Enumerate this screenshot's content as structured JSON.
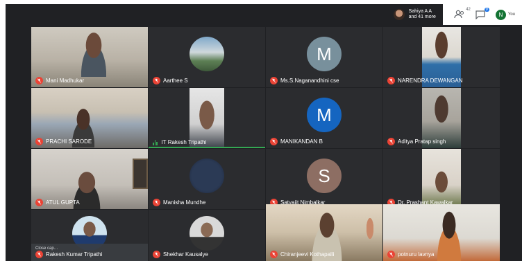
{
  "topbar": {
    "presenter_name": "Sahiya A A",
    "presenter_more": "and 41 more",
    "people_count": "42",
    "chat_badge": "9",
    "self_initial": "N",
    "self_label": "You",
    "self_badge": "9"
  },
  "participants": [
    {
      "name": "Mani Madhukar",
      "kind": "video"
    },
    {
      "name": "Aarthee S",
      "kind": "photo"
    },
    {
      "name": "Ms.S.Naganandhini cse",
      "kind": "letter",
      "initial": "M",
      "color": "#78909c"
    },
    {
      "name": "NARENDRA DEWANGAN",
      "kind": "video"
    },
    {
      "name": "PRACHI SARODE",
      "kind": "video"
    },
    {
      "name": "IT Rakesh Tripathi",
      "kind": "video",
      "speaking": true
    },
    {
      "name": "MANIKANDAN B",
      "kind": "letter",
      "initial": "M",
      "color": "#1565c0"
    },
    {
      "name": "Aditya Pratap singh",
      "kind": "video"
    },
    {
      "name": "ATUL GUPTA",
      "kind": "video"
    },
    {
      "name": "Manisha Mundhe",
      "kind": "photo"
    },
    {
      "name": "Satyajit Nimbalkar",
      "kind": "letter",
      "initial": "S",
      "color": "#8d6e63"
    },
    {
      "name": "Dr. Prashant Kawalkar",
      "kind": "video"
    },
    {
      "name": "Rakesh Kumar Tripathi",
      "kind": "photo"
    },
    {
      "name": "Shekhar Kausalye",
      "kind": "photo"
    },
    {
      "name": "Chiranjeevi Kothapalli",
      "kind": "video"
    },
    {
      "name": "potnuru lavnya",
      "kind": "video"
    }
  ],
  "captions": {
    "text": "Close cap…"
  },
  "colors": {
    "mute_red": "#ea4335",
    "speaking_green": "#34a853",
    "tile_bg": "#2b2c2f",
    "stage_bg": "#202124"
  }
}
